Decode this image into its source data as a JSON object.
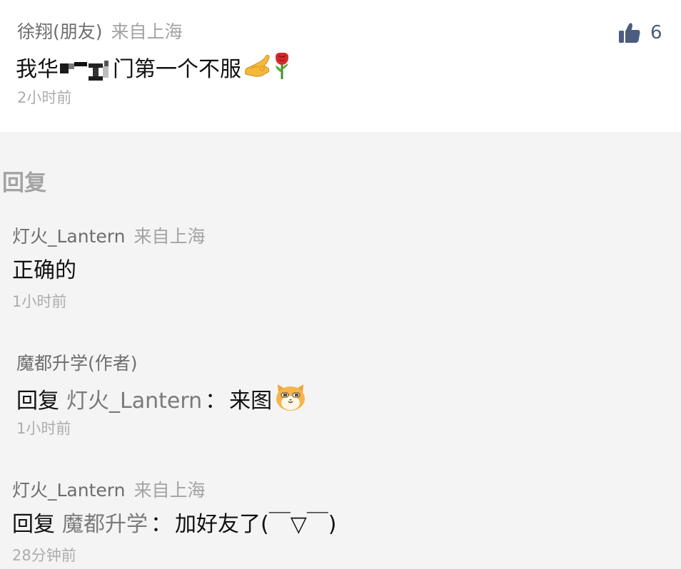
{
  "main_comment": {
    "author": "徐翔(朋友)",
    "location": "来自上海",
    "text_before": "我华",
    "text_after": "门第一个不服",
    "time": "2小时前",
    "likes": "6"
  },
  "replies_title": "回复",
  "replies": [
    {
      "author": "灯火_Lantern",
      "location": "来自上海",
      "text": "正确的",
      "time": "1小时前"
    },
    {
      "author": "魔都升学(作者)",
      "reply_prefix": "回复",
      "reply_target": "灯火_Lantern",
      "colon": "：",
      "text": "来图",
      "time": "1小时前"
    },
    {
      "author": "灯火_Lantern",
      "location": "来自上海",
      "reply_prefix": "回复",
      "reply_target": "魔都升学",
      "colon": "：",
      "text": "加好友了(￣▽￣)",
      "time": "28分钟前"
    }
  ]
}
